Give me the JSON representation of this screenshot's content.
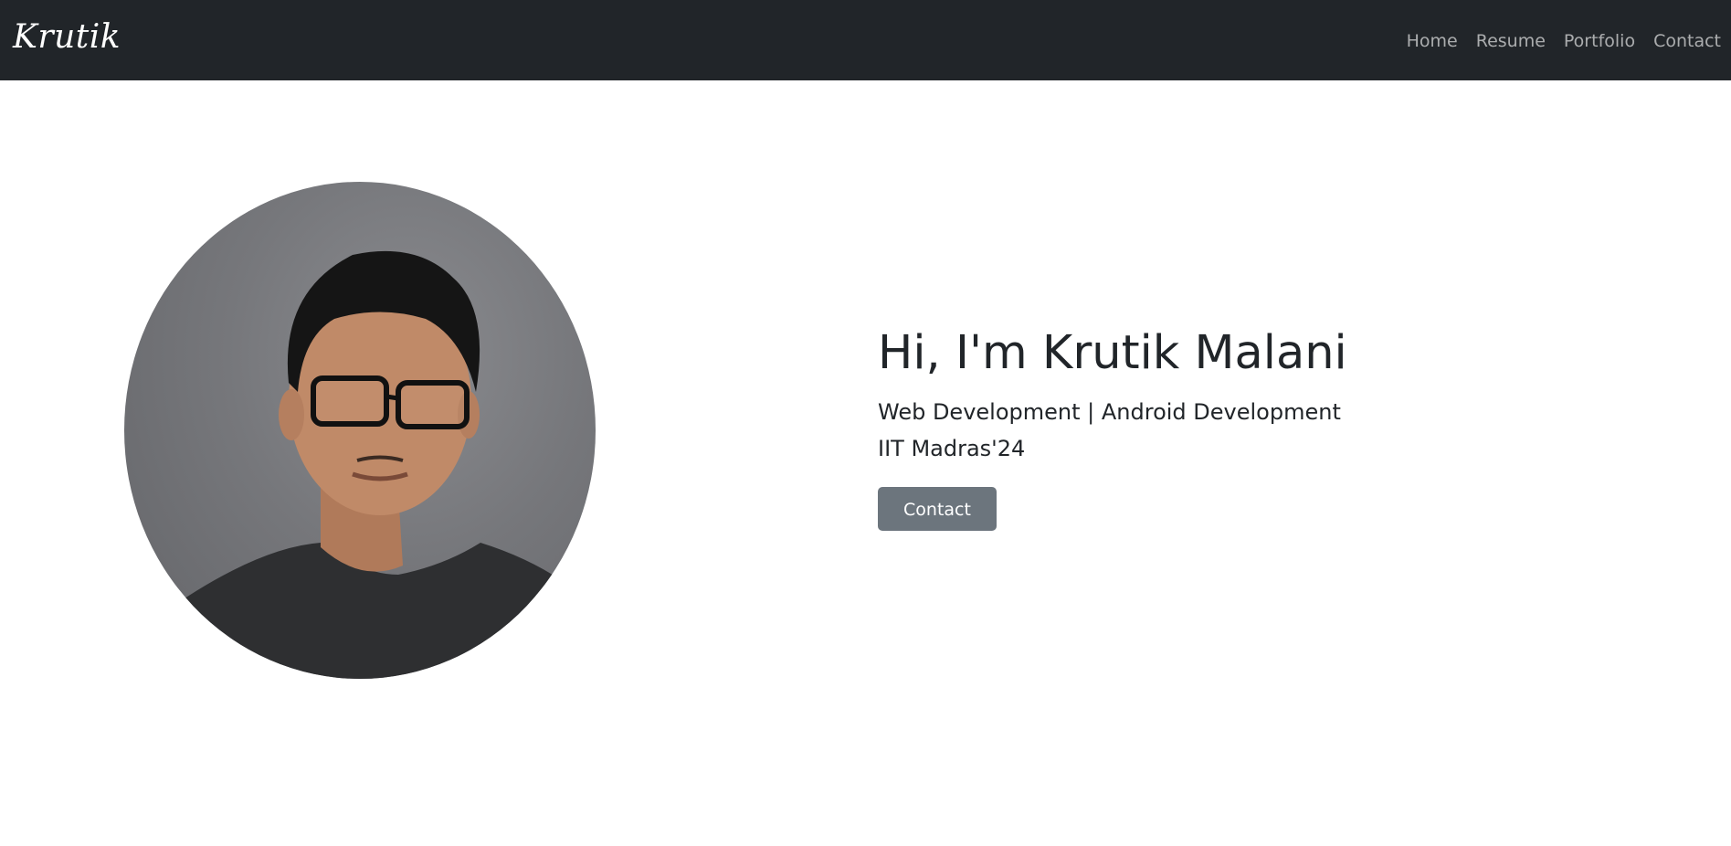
{
  "navbar": {
    "brand": "Krutik",
    "links": [
      {
        "label": "Home"
      },
      {
        "label": "Resume"
      },
      {
        "label": "Portfolio"
      },
      {
        "label": "Contact"
      }
    ]
  },
  "hero": {
    "title": "Hi, I'm Krutik Malani",
    "subtitle_line1": "Web Development | Android Development",
    "subtitle_line2": "IIT Madras'24",
    "button_label": "Contact"
  },
  "colors": {
    "navbar_bg": "#212529",
    "button_bg": "#6c757d",
    "text": "#212529"
  }
}
